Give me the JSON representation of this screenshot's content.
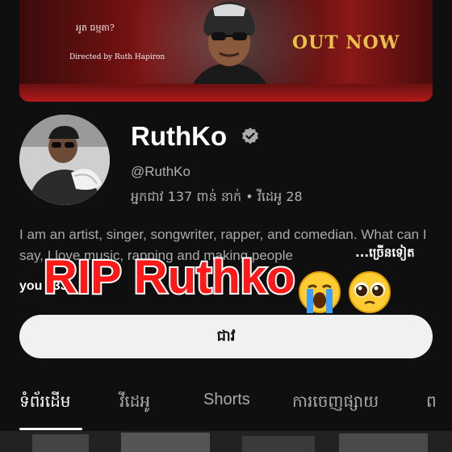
{
  "banner": {
    "film_title": "អូត ធម្មតា?",
    "credit": "Directed by Ruth Hapiron",
    "out_now": "OUT NOW"
  },
  "channel": {
    "name": "RuthKo",
    "handle": "@RuthKo",
    "stats": "អ្នកជាវ 137 ពាន់ នាក់ • វីដេអូ 28",
    "description": "I am an artist, singer, songwriter, rapper, and comedian. What can I say, I love music, rapping and making people",
    "more": "...ច្រើនទៀត",
    "link": "you  133"
  },
  "overlay": {
    "text": "RIP Ruthko",
    "emoji1": "loudly-crying-face",
    "emoji2": "pleading-face"
  },
  "subscribe_label": "ជាវ",
  "tabs": [
    {
      "label": "ទំព័រដើម",
      "active": true
    },
    {
      "label": "វីដេអូ",
      "active": false
    },
    {
      "label": "Shorts",
      "active": false
    },
    {
      "label": "ការចេញផ្សាយ",
      "active": false
    },
    {
      "label": "ព",
      "active": false
    }
  ],
  "colors": {
    "background": "#0f0f0f",
    "overlay_text": "#ff1a1a",
    "out_now": "#e7c24a"
  }
}
